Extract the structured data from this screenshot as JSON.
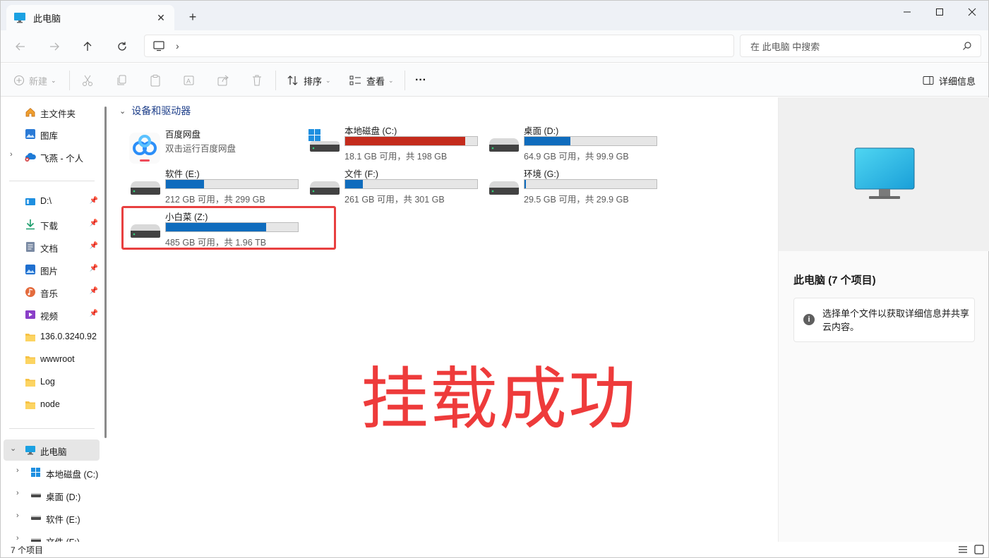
{
  "tab": {
    "title": "此电脑",
    "close": "✕",
    "new_tab": "+"
  },
  "address": {
    "separator": "›"
  },
  "search": {
    "placeholder": "在 此电脑 中搜索"
  },
  "toolbar": {
    "new_label": "新建",
    "sort_label": "排序",
    "view_label": "查看",
    "more": "···",
    "details_label": "详细信息"
  },
  "sidebar": {
    "home": "主文件夹",
    "gallery": "图库",
    "onedrive": "飞燕 - 个人",
    "quick": [
      {
        "label": "D:\\",
        "pinned": true
      },
      {
        "label": "下载",
        "pinned": true
      },
      {
        "label": "文档",
        "pinned": true
      },
      {
        "label": "图片",
        "pinned": true
      },
      {
        "label": "音乐",
        "pinned": true
      },
      {
        "label": "视频",
        "pinned": true
      },
      {
        "label": "136.0.3240.92",
        "pinned": false
      },
      {
        "label": "wwwroot",
        "pinned": false
      },
      {
        "label": "Log",
        "pinned": false
      },
      {
        "label": "node",
        "pinned": false
      }
    ],
    "this_pc": "此电脑",
    "drives": [
      "本地磁盘 (C:)",
      "桌面 (D:)",
      "软件 (E:)",
      "文件 (F:)"
    ]
  },
  "main": {
    "section_title": "设备和驱动器",
    "baidu": {
      "name": "百度网盘",
      "sub": "双击运行百度网盘"
    },
    "drives": [
      {
        "name": "本地磁盘 (C:)",
        "info": "18.1 GB 可用，共 198 GB",
        "used_pct": 90.9,
        "os": true
      },
      {
        "name": "桌面 (D:)",
        "info": "64.9 GB 可用，共 99.9 GB",
        "used_pct": 35.0,
        "os": false
      },
      {
        "name": "软件 (E:)",
        "info": "212 GB 可用，共 299 GB",
        "used_pct": 29.1,
        "os": false
      },
      {
        "name": "文件 (F:)",
        "info": "261 GB 可用，共 301 GB",
        "used_pct": 13.3,
        "os": false
      },
      {
        "name": "环境 (G:)",
        "info": "29.5 GB 可用，共 29.9 GB",
        "used_pct": 1.3,
        "os": false
      },
      {
        "name": "小白菜 (Z:)",
        "info": "485 GB 可用，共 1.96 TB",
        "used_pct": 75.8,
        "os": false
      }
    ],
    "annotation": "挂载成功"
  },
  "details": {
    "title": "此电脑 (7 个项目)",
    "hint": "选择单个文件以获取详细信息并共享云内容。"
  },
  "status": {
    "count": "7 个项目"
  },
  "colors": {
    "accent": "#0f6cbd",
    "bar_full": "#c42b1c",
    "highlight": "#e84040",
    "annotation": "#ee3b3b"
  }
}
